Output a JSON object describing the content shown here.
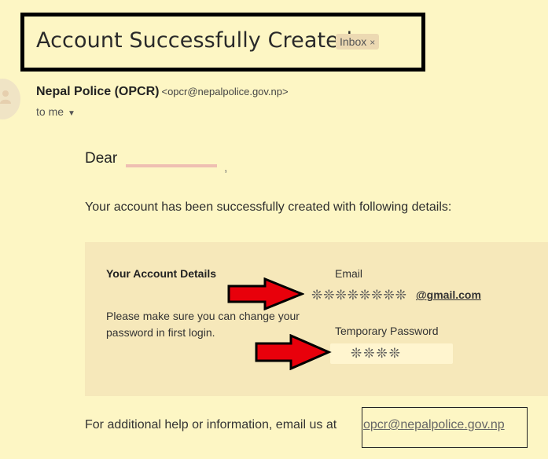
{
  "email": {
    "subject": "Account Successfully Created",
    "label_badge": "Inbox",
    "label_badge_close": "×",
    "sender_name": "Nepal Police (OPCR)",
    "sender_email": "<opcr@nepalpolice.gov.np>",
    "recipient": "to me",
    "recipient_caret": "▼"
  },
  "body": {
    "greeting": "Dear",
    "greeting_comma": ",",
    "intro": "Your account has been successfully created with following details:",
    "details": {
      "heading": "Your Account Details",
      "note": "Please make sure you can change your password in first login.",
      "email_label": "Email",
      "email_masked": "❊❊❊❊❊❊❊❊",
      "email_domain": "@gmail.com",
      "password_label": "Temporary Password",
      "password_masked": "❊❊❊❊"
    },
    "footer_text": "For additional help or information, email us at",
    "footer_link": "opcr@nepalpolice.gov.np"
  },
  "colors": {
    "page_background": "#fdf6c4",
    "arrow_fill": "#e8000b",
    "details_background": "#f6e8ba"
  },
  "icons": {
    "avatar": "person-icon",
    "arrows": "red-arrow-icon"
  }
}
